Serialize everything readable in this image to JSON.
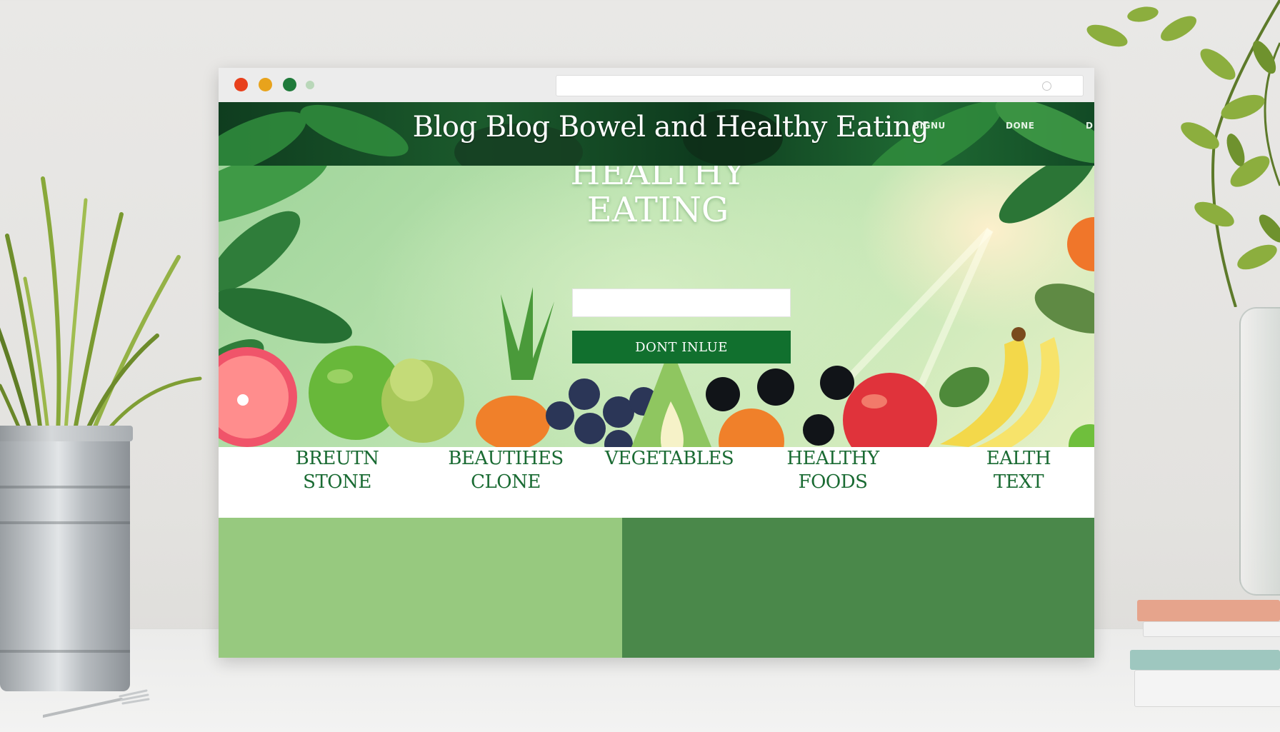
{
  "site": {
    "title": "Blog Blog Bowel and Healthy Eating",
    "nav": [
      "BIGNU",
      "DONE",
      "D"
    ]
  },
  "hero": {
    "title_line1": "HEALTHY",
    "title_line2": "EATING",
    "input_value": "",
    "button_label": "DONT INLUE"
  },
  "categories": [
    {
      "line1": "BREUTN",
      "line2": "STONE"
    },
    {
      "line1": "BEAUTIHES",
      "line2": "CLONE"
    },
    {
      "line1": "VEGETABLES",
      "line2": ""
    },
    {
      "line1": "HEALTHY",
      "line2": "FOODS"
    },
    {
      "line1": "EALTH",
      "line2": "TEXT"
    }
  ],
  "colors": {
    "header_green": "#1b5a2c",
    "button_green": "#11702e",
    "category_text": "#1a6b33",
    "panel_light": "#97c97f",
    "panel_dark": "#4a884a",
    "dot_red": "#e8401c",
    "dot_yellow": "#e8a31c",
    "dot_green": "#1f7a3a"
  },
  "icons": {
    "window_controls": [
      "close-dot",
      "minimize-dot",
      "maximize-dot",
      "extra-dot"
    ],
    "address_bar": "reload-icon"
  }
}
